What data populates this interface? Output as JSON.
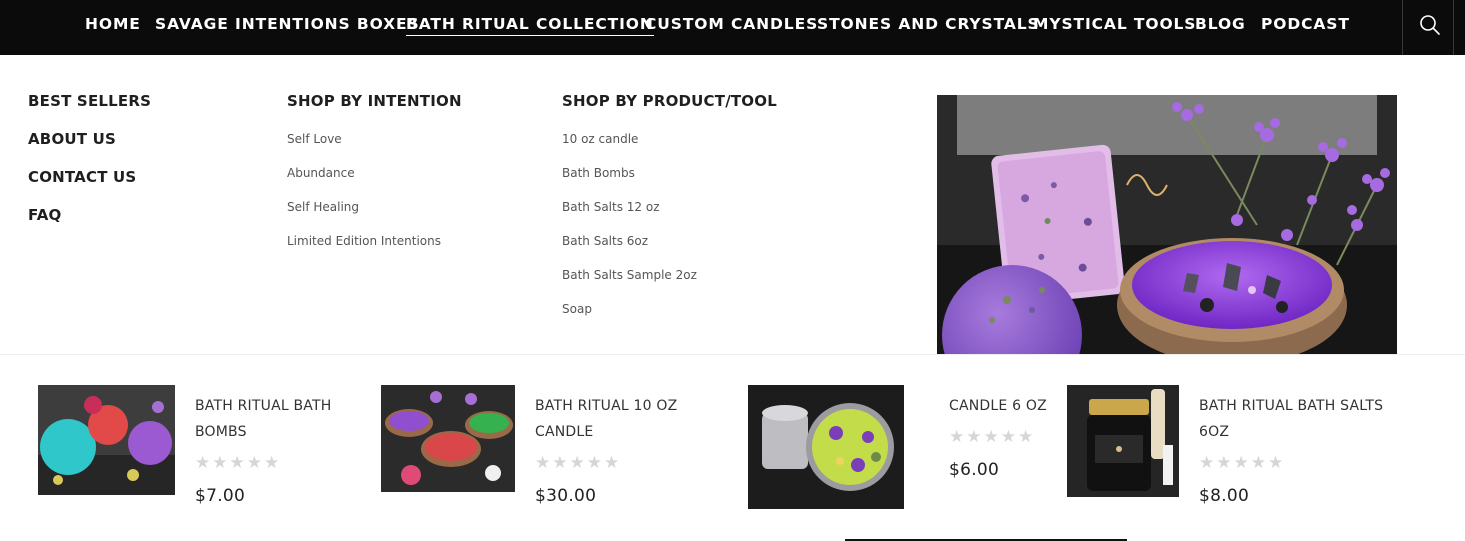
{
  "nav": {
    "items": [
      {
        "label": "HOME"
      },
      {
        "label": "SAVAGE INTENTIONS BOXES"
      },
      {
        "label": "BATH RITUAL COLLECTION"
      },
      {
        "label": "CUSTOM CANDLES"
      },
      {
        "label": "STONES AND CRYSTALS"
      },
      {
        "label": "MYSTICAL TOOLS"
      },
      {
        "label": "BLOG"
      },
      {
        "label": "PODCAST"
      }
    ],
    "active": "BATH RITUAL COLLECTION",
    "search_icon": "search-icon"
  },
  "menu": {
    "main_links": [
      {
        "label": "BEST SELLERS"
      },
      {
        "label": "ABOUT US"
      },
      {
        "label": "CONTACT US"
      },
      {
        "label": "FAQ"
      }
    ],
    "intention": {
      "heading": "SHOP BY INTENTION",
      "links": [
        {
          "label": "Self Love"
        },
        {
          "label": "Abundance"
        },
        {
          "label": "Self Healing"
        },
        {
          "label": "Limited Edition Intentions"
        }
      ]
    },
    "product_tool": {
      "heading": "SHOP BY PRODUCT/TOOL",
      "links": [
        {
          "label": "10 oz candle"
        },
        {
          "label": "Bath Bombs"
        },
        {
          "label": "Bath Salts 12 oz"
        },
        {
          "label": "Bath Salts 6oz"
        },
        {
          "label": "Bath Salts Sample 2oz"
        },
        {
          "label": "Soap"
        }
      ]
    }
  },
  "products": [
    {
      "title_line1": "BATH RITUAL BATH",
      "title_line2": "BOMBS",
      "rating": 0,
      "max_rating": 5,
      "stars": "★★★★★",
      "price": "$7.00"
    },
    {
      "title_line1": "BATH RITUAL 10 OZ",
      "title_line2": "CANDLE",
      "rating": 0,
      "max_rating": 5,
      "stars": "★★★★★",
      "price": "$30.00"
    },
    {
      "title_line1": "CANDLE 6 OZ",
      "title_line2": "",
      "rating": 0,
      "max_rating": 5,
      "stars": "★★★★★",
      "price": "$6.00"
    },
    {
      "title_line1": "BATH RITUAL BATH SALTS",
      "title_line2": "6OZ",
      "rating": 0,
      "max_rating": 5,
      "stars": "★★★★★",
      "price": "$8.00"
    }
  ],
  "colors": {
    "nav_bg": "#0b0b0b",
    "nav_text": "#ffffff",
    "star_empty": "#d6d6d6",
    "accent_purple": "#8e44d8"
  }
}
